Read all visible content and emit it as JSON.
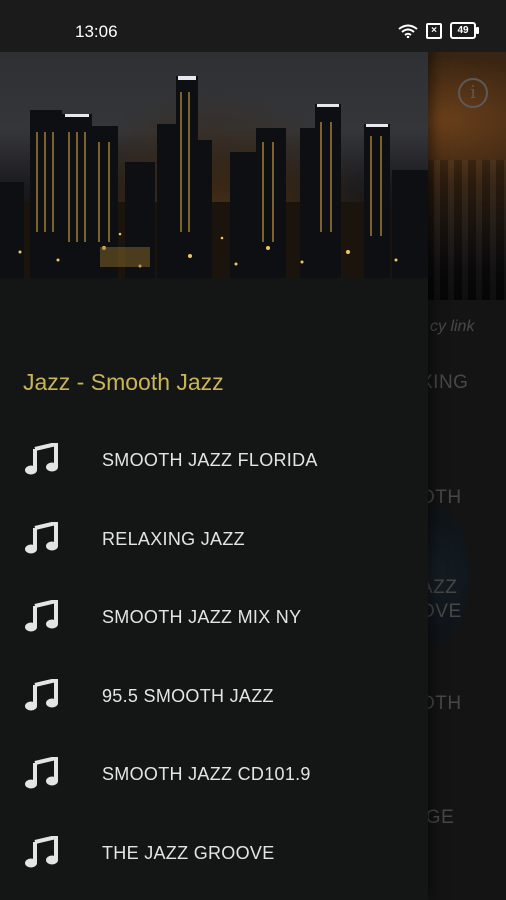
{
  "status_bar": {
    "time": "13:06",
    "battery": "49"
  },
  "background_app": {
    "info_icon": "info-icon",
    "privacy_text": "cy link",
    "list_fragments": [
      "XING",
      "OTH",
      "AZZ",
      "OVE",
      "OTH",
      "IGE"
    ]
  },
  "drawer": {
    "header_image": "city-skyline-night",
    "section_title": "Jazz - Smooth Jazz",
    "items": [
      {
        "label": "SMOOTH JAZZ FLORIDA",
        "icon": "music-note-icon"
      },
      {
        "label": "RELAXING JAZZ",
        "icon": "music-note-icon"
      },
      {
        "label": "SMOOTH JAZZ MIX NY",
        "icon": "music-note-icon"
      },
      {
        "label": "95.5 SMOOTH JAZZ",
        "icon": "music-note-icon"
      },
      {
        "label": "SMOOTH JAZZ CD101.9",
        "icon": "music-note-icon"
      },
      {
        "label": "THE JAZZ GROOVE",
        "icon": "music-note-icon"
      }
    ]
  },
  "colors": {
    "accent": "#c9b458",
    "drawer_bg": "#141515",
    "item_text": "#e4e4e4"
  }
}
